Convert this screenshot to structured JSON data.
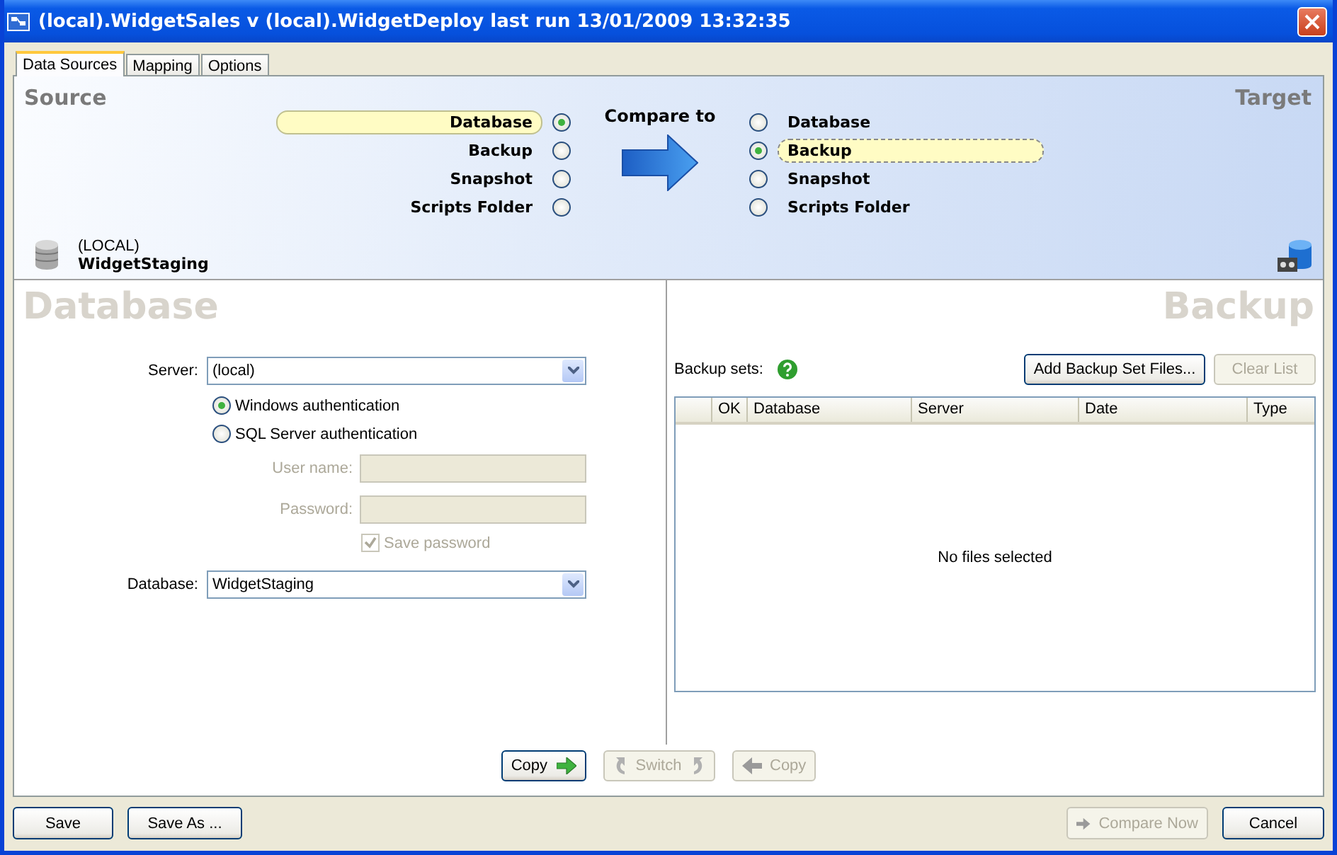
{
  "window": {
    "title": "(local).WidgetSales v (local).WidgetDeploy last run 13/01/2009 13:32:35"
  },
  "tabs": [
    {
      "label": "Data Sources",
      "selected": true
    },
    {
      "label": "Mapping",
      "selected": false
    },
    {
      "label": "Options",
      "selected": false
    }
  ],
  "source": {
    "heading": "Source",
    "options": [
      {
        "label": "Database",
        "selected": true
      },
      {
        "label": "Backup",
        "selected": false
      },
      {
        "label": "Snapshot",
        "selected": false
      },
      {
        "label": "Scripts Folder",
        "selected": false
      }
    ],
    "server": "(LOCAL)",
    "database": "WidgetStaging"
  },
  "compare_label": "Compare to",
  "target": {
    "heading": "Target",
    "options": [
      {
        "label": "Database",
        "selected": false
      },
      {
        "label": "Backup",
        "selected": true
      },
      {
        "label": "Snapshot",
        "selected": false
      },
      {
        "label": "Scripts Folder",
        "selected": false
      }
    ]
  },
  "source_panel": {
    "heading": "Database",
    "server_label": "Server:",
    "server_value": "(local)",
    "auth_options": [
      {
        "label": "Windows authentication",
        "selected": true
      },
      {
        "label": "SQL Server authentication",
        "selected": false
      }
    ],
    "user_field": {
      "label": "User name:",
      "disabled": true
    },
    "password_field": {
      "label": "Password:",
      "disabled": true
    },
    "save_password": {
      "label": "Save password",
      "checked": true,
      "disabled": true
    },
    "database_label": "Database:",
    "database_value": "WidgetStaging"
  },
  "target_panel": {
    "heading": "Backup",
    "sets_label": "Backup sets:",
    "add_button": {
      "label": "Add Backup Set Files...",
      "disabled": false
    },
    "clear_button": {
      "label": "Clear List",
      "disabled": true
    },
    "columns": [
      "OK",
      "Database",
      "Server",
      "Date",
      "Type"
    ],
    "empty_message": "No files selected"
  },
  "transfer_buttons": [
    {
      "label": "Copy",
      "kind": "copy-right",
      "disabled": false
    },
    {
      "label": "Switch",
      "kind": "switch",
      "disabled": true
    },
    {
      "label": "Copy",
      "kind": "copy-left",
      "disabled": true
    }
  ],
  "footer": {
    "left_buttons": [
      {
        "label": "Save"
      },
      {
        "label": "Save As ..."
      }
    ],
    "compare_button": {
      "label": "Compare Now",
      "disabled": true
    },
    "cancel_button": {
      "label": "Cancel",
      "disabled": false
    }
  }
}
